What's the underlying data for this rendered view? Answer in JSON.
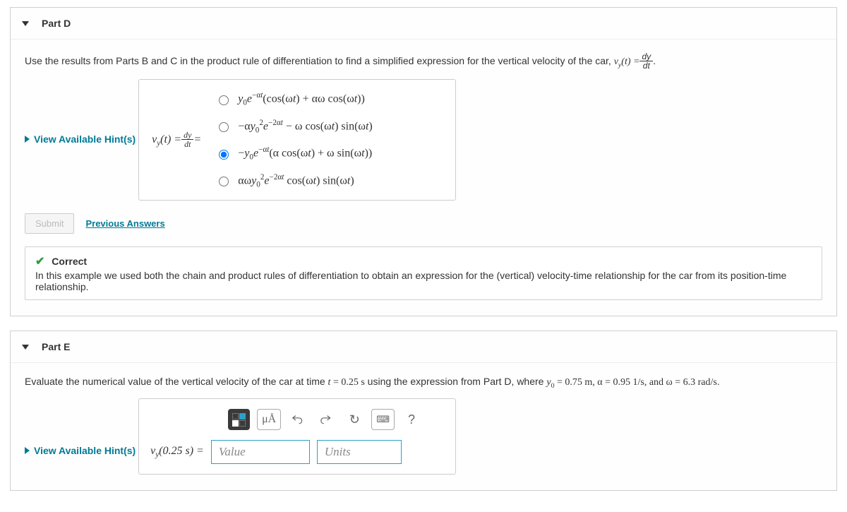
{
  "partD": {
    "title": "Part D",
    "prompt_pre": "Use the results from Parts B and C in the product rule of differentiation to find a simplified expression for the vertical velocity of the car, ",
    "prompt_post": ".",
    "hints_label": "View Available Hint(s)",
    "lhs": "v_y(t) = dy/dt =",
    "options": [
      "y₀e^{-αt}(cos(ωt) + αω cos(ωt))",
      "−αy₀² e^{-2αt} − ω cos(ωt) sin(ωt)",
      "−y₀e^{-αt}(α cos(ωt) + ω sin(ωt))",
      "αωy₀² e^{-2αt} cos(ωt) sin(ωt)"
    ],
    "selected_index": 2,
    "submit_label": "Submit",
    "prev_answers_label": "Previous Answers",
    "feedback_title": "Correct",
    "feedback_body": "In this example we used both the chain and product rules of differentiation to obtain an expression for the (vertical) velocity-time relationship for the car from its position-time relationship."
  },
  "partE": {
    "title": "Part E",
    "prompt_pre": "Evaluate the numerical value of the vertical velocity of the car at time ",
    "prompt_mid": " using the expression from Part D, where ",
    "prompt_post": ".",
    "t_val": "t = 0.25 s",
    "givens": "y₀ = 0.75 m, α = 0.95 1/s, and ω = 6.3 rad/s",
    "hints_label": "View Available Hint(s)",
    "lhs": "v_y(0.25 s) =",
    "value_placeholder": "Value",
    "units_placeholder": "Units",
    "toolbar": {
      "templates": "templates",
      "units_btn": "μÅ",
      "undo": "↶",
      "redo": "↷",
      "reset": "↻",
      "keyboard": "⌨",
      "help": "?"
    }
  }
}
